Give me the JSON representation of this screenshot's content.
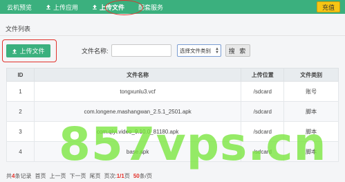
{
  "nav": {
    "items": [
      {
        "label": "云机预览",
        "icon": ""
      },
      {
        "label": "上传应用",
        "icon": "upload-icon"
      },
      {
        "label": "上传文件",
        "icon": "upload-icon"
      },
      {
        "label": "配套服务",
        "icon": ""
      }
    ],
    "active": "上传文件",
    "recharge_label": "充值"
  },
  "section_title": "文件列表",
  "toolbar": {
    "upload_label": "上传文件",
    "filename_label": "文件名称:",
    "filename_value": "",
    "type_select_value": "选择文件类别",
    "search_label": "搜 索"
  },
  "table": {
    "headers": [
      "ID",
      "文件名称",
      "上传位置",
      "文件类别"
    ],
    "rows": [
      [
        "1",
        "tongxunlu3.vcf",
        "/sdcard",
        "账号"
      ],
      [
        "2",
        "com.longene.mashangwan_2.5.1_2501.apk",
        "/sdcard",
        "脚本"
      ],
      [
        "3",
        "com.qiyi.video_9.10.0_81180.apk",
        "/sdcard",
        "脚本"
      ],
      [
        "4",
        "base.apk",
        "/sdcard",
        "脚本"
      ]
    ]
  },
  "pager": {
    "total_prefix": "共",
    "total_count": "4",
    "total_suffix": "条记录",
    "first": "首页",
    "prev": "上一页",
    "next": "下一页",
    "last": "尾页",
    "page_label": "页次:",
    "page_value": "1/1",
    "page_unit": "页",
    "per_page": "50",
    "per_page_suffix": "条/页"
  },
  "watermark": "857vps.cn",
  "colors": {
    "nav_bg": "#3bb07e",
    "accent": "#3bb07e",
    "recharge": "#f7c514",
    "annotation": "#e2312a",
    "watermark": "#78e63c"
  }
}
